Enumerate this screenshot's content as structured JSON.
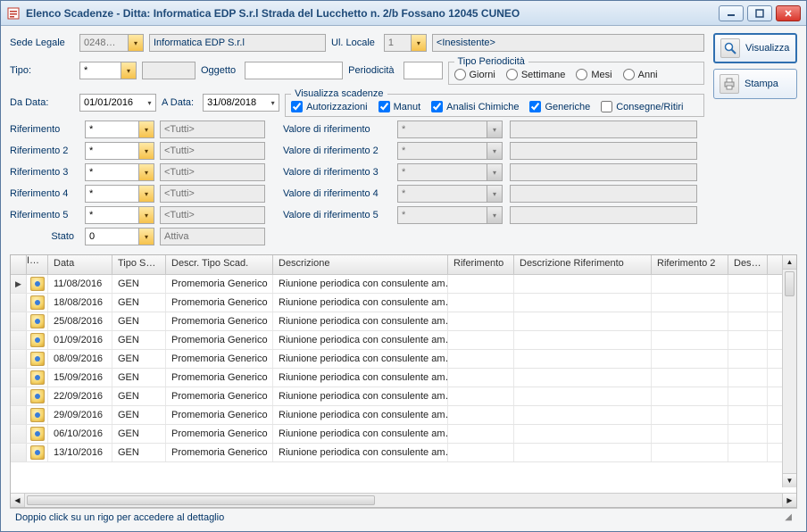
{
  "window": {
    "title": "Elenco Scadenze - Ditta: Informatica EDP S.r.l Strada del Lucchetto n. 2/b Fossano 12045 CUNEO"
  },
  "actions": {
    "visualizza": "Visualizza",
    "stampa": "Stampa"
  },
  "header": {
    "sede_legale_label": "Sede Legale",
    "sede_legale_code": "0248…",
    "sede_legale_nome": "Informatica EDP S.r.l",
    "ul_locale_label": "Ul. Locale",
    "ul_locale_value": "1",
    "ul_locale_display": "<Inesistente>",
    "tipo_label": "Tipo:",
    "tipo_value": "*",
    "oggetto_label": "Oggetto",
    "oggetto_value": "",
    "periodicita_label": "Periodicità",
    "periodicita_value": "",
    "tipo_periodicita_legend": "Tipo Periodicità",
    "tp_options": {
      "giorni": "Giorni",
      "settimane": "Settimane",
      "mesi": "Mesi",
      "anni": "Anni"
    },
    "da_data_label": "Da Data:",
    "da_data": "01/01/2016",
    "a_data_label": "A Data:",
    "a_data": "31/08/2018",
    "vis_scad_legend": "Visualizza scadenze",
    "cb": {
      "autorizzazioni": {
        "label": "Autorizzazioni",
        "checked": true
      },
      "manut": {
        "label": "Manut",
        "checked": true
      },
      "analisi": {
        "label": "Analisi Chimiche",
        "checked": true
      },
      "generiche": {
        "label": "Generiche",
        "checked": true
      },
      "consegne": {
        "label": "Consegne/Ritiri",
        "checked": false
      }
    },
    "rif": [
      {
        "label": "Riferimento",
        "value": "*",
        "display": "<Tutti>"
      },
      {
        "label": "Riferimento 2",
        "value": "*",
        "display": "<Tutti>"
      },
      {
        "label": "Riferimento 3",
        "value": "*",
        "display": "<Tutti>"
      },
      {
        "label": "Riferimento 4",
        "value": "*",
        "display": "<Tutti>"
      },
      {
        "label": "Riferimento 5",
        "value": "*",
        "display": "<Tutti>"
      }
    ],
    "valref": [
      {
        "label": "Valore di riferimento",
        "value": "*"
      },
      {
        "label": "Valore di riferimento 2",
        "value": "*"
      },
      {
        "label": "Valore di riferimento 3",
        "value": "*"
      },
      {
        "label": "Valore di riferimento 4",
        "value": "*"
      },
      {
        "label": "Valore di riferimento 5",
        "value": "*"
      }
    ],
    "stato_label": "Stato",
    "stato_value": "0",
    "stato_display": "Attiva"
  },
  "grid": {
    "columns": {
      "ico": "I…",
      "data": "Data",
      "tipo": "Tipo Scad.",
      "descrt": "Descr. Tipo Scad.",
      "desc": "Descrizione",
      "rif": "Riferimento",
      "descrif": "Descrizione Riferimento",
      "rif2": "Riferimento 2",
      "descri2": "Descri…"
    },
    "rows": [
      {
        "data": "11/08/2016",
        "tipo": "GEN",
        "descrt": "Promemoria Generico",
        "desc": "Riunione periodica con consulente am…"
      },
      {
        "data": "18/08/2016",
        "tipo": "GEN",
        "descrt": "Promemoria Generico",
        "desc": "Riunione periodica con consulente am…"
      },
      {
        "data": "25/08/2016",
        "tipo": "GEN",
        "descrt": "Promemoria Generico",
        "desc": "Riunione periodica con consulente am…"
      },
      {
        "data": "01/09/2016",
        "tipo": "GEN",
        "descrt": "Promemoria Generico",
        "desc": "Riunione periodica con consulente am…"
      },
      {
        "data": "08/09/2016",
        "tipo": "GEN",
        "descrt": "Promemoria Generico",
        "desc": "Riunione periodica con consulente am…"
      },
      {
        "data": "15/09/2016",
        "tipo": "GEN",
        "descrt": "Promemoria Generico",
        "desc": "Riunione periodica con consulente am…"
      },
      {
        "data": "22/09/2016",
        "tipo": "GEN",
        "descrt": "Promemoria Generico",
        "desc": "Riunione periodica con consulente am…"
      },
      {
        "data": "29/09/2016",
        "tipo": "GEN",
        "descrt": "Promemoria Generico",
        "desc": "Riunione periodica con consulente am…"
      },
      {
        "data": "06/10/2016",
        "tipo": "GEN",
        "descrt": "Promemoria Generico",
        "desc": "Riunione periodica con consulente am…"
      },
      {
        "data": "13/10/2016",
        "tipo": "GEN",
        "descrt": "Promemoria Generico",
        "desc": "Riunione periodica con consulente am…"
      }
    ]
  },
  "statusbar": {
    "hint": "Doppio click su un rigo per accedere al dettaglio"
  }
}
